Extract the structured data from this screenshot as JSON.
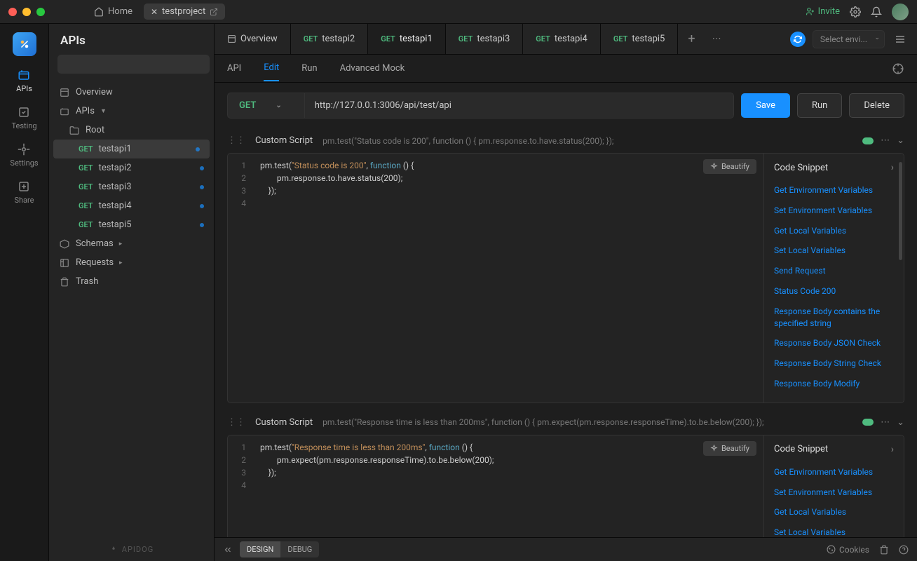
{
  "titlebar": {
    "home": "Home",
    "project_tab": "testproject",
    "invite": "Invite"
  },
  "activity": {
    "apis": "APIs",
    "testing": "Testing",
    "settings": "Settings",
    "share": "Share"
  },
  "sidebar": {
    "title": "APIs",
    "overview": "Overview",
    "apis_label": "APIs",
    "root": "Root",
    "apis": [
      {
        "method": "GET",
        "name": "testapi1"
      },
      {
        "method": "GET",
        "name": "testapi2"
      },
      {
        "method": "GET",
        "name": "testapi3"
      },
      {
        "method": "GET",
        "name": "testapi4"
      },
      {
        "method": "GET",
        "name": "testapi5"
      }
    ],
    "schemas": "Schemas",
    "requests": "Requests",
    "trash": "Trash",
    "footer": "APIDOG"
  },
  "tabs": {
    "overview": "Overview",
    "items": [
      {
        "method": "GET",
        "name": "testapi2"
      },
      {
        "method": "GET",
        "name": "testapi1"
      },
      {
        "method": "GET",
        "name": "testapi3"
      },
      {
        "method": "GET",
        "name": "testapi4"
      },
      {
        "method": "GET",
        "name": "testapi5"
      }
    ],
    "env_placeholder": "Select envi..."
  },
  "subtabs": {
    "api": "API",
    "edit": "Edit",
    "run": "Run",
    "mock": "Advanced Mock"
  },
  "request": {
    "method": "GET",
    "url": "http://127.0.0.1:3006/api/test/api",
    "save": "Save",
    "run": "Run",
    "delete": "Delete"
  },
  "scripts": [
    {
      "title": "Custom Script",
      "preview": "pm.test(\"Status code is 200\", function () { pm.response.to.have.status(200); });",
      "code": {
        "line1_a": "pm.test(",
        "line1_b": "\"Status code is 200\"",
        "line1_c": ", ",
        "line1_d": "function",
        "line1_e": " () {",
        "line2": "        pm.response.to.have.status(200);",
        "line3": "    });"
      }
    },
    {
      "title": "Custom Script",
      "preview": "pm.test(\"Response time is less than 200ms\", function () { pm.expect(pm.response.responseTime).to.be.below(200); });",
      "code": {
        "line1_a": "pm.test(",
        "line1_b": "\"Response time is less than 200ms\"",
        "line1_c": ", ",
        "line1_d": "function",
        "line1_e": " () {",
        "line2": "        pm.expect(pm.response.responseTime).to.be.below(200);",
        "line3": "    });"
      }
    }
  ],
  "editor": {
    "beautify": "Beautify",
    "snippet_title": "Code Snippet",
    "snippets": [
      "Get Environment Variables",
      "Set Environment Variables",
      "Get Local Variables",
      "Set Local Variables",
      "Send Request",
      "Status Code 200",
      "Response Body contains the specified string",
      "Response Body JSON Check",
      "Response Body String Check",
      "Response Body Modify"
    ],
    "snippets_short": [
      "Get Environment Variables",
      "Set Environment Variables",
      "Get Local Variables",
      "Set Local Variables"
    ]
  },
  "statusbar": {
    "design": "DESIGN",
    "debug": "DEBUG",
    "cookies": "Cookies"
  }
}
